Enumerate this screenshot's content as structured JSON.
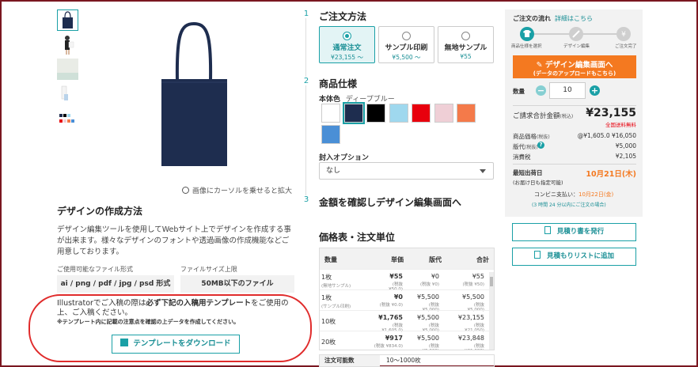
{
  "product": {
    "zoom_hint": "画像にカーソルを乗せると拡大",
    "thumbnails": [
      "tote-navy",
      "model-photo",
      "tote-natural",
      "tote-white",
      "color-variants"
    ]
  },
  "design_howto": {
    "title": "デザインの作成方法",
    "description": "デザイン編集ツールを使用してWebサイト上でデザインを作成する事が出来ます。様々なデザインのフォントや透過画像の作成機能などご用意しております。",
    "file_types_label": "ご使用可能なファイル形式",
    "file_types_value": "ai / png / pdf / jpg / psd 形式",
    "file_size_label": "ファイルサイズ上限",
    "file_size_value": "50MB以下のファイル",
    "note_part1": "Illustratorでご入稿の際は",
    "note_bold": "必ず下記の入稿用テンプレート",
    "note_part2": "をご使用の上、ご入稿ください。",
    "note_small": "※テンプレート内に記載の注意点を確認の上データを作成してください。",
    "download_button": "テンプレートをダウンロード"
  },
  "steps": {
    "step1": {
      "num": "1",
      "title": "ご注文方法"
    },
    "step2": {
      "num": "2",
      "title": "商品仕様"
    },
    "step3": {
      "num": "3",
      "title": "金額を確認しデザイン編集画面へ"
    }
  },
  "order_methods": [
    {
      "title": "通常注文",
      "price": "¥23,155 〜",
      "selected": true
    },
    {
      "title": "サンプル印刷",
      "price": "¥5,500 〜",
      "selected": false
    },
    {
      "title": "無地サンプル",
      "price": "¥55",
      "selected": false
    }
  ],
  "body_color": {
    "label": "本体色",
    "value": "ディープブルー",
    "swatches": [
      "#ffffff",
      "#1e2d4f",
      "#000000",
      "#9fd8ee",
      "#e8000d",
      "#efcfd6",
      "#f47a4a",
      "#4a8fd6"
    ],
    "selected_index": 1
  },
  "sealing": {
    "label": "封入オプション",
    "value": "なし"
  },
  "price_table": {
    "title": "価格表・注文単位",
    "headers": [
      "数量",
      "単価",
      "版代",
      "合計"
    ],
    "rows": [
      {
        "qty": "1枚",
        "qty_sub": "(無地サンプル)",
        "unit": "¥55",
        "unit_sub": "(税抜 ¥50.0)",
        "plate": "¥0",
        "plate_sub": "(税抜 ¥0)",
        "total": "¥55",
        "total_sub": "(税抜 ¥50)"
      },
      {
        "qty": "1枚",
        "qty_sub": "(サンプル印刷)",
        "unit": "¥0",
        "unit_sub": "(税抜 ¥0.0)",
        "plate": "¥5,500",
        "plate_sub": "(税抜 ¥5,000)",
        "total": "¥5,500",
        "total_sub": "(税抜 ¥5,000)"
      },
      {
        "qty": "10枚",
        "qty_sub": "",
        "unit": "¥1,765",
        "unit_sub": "(税抜 ¥1,605.0)",
        "plate": "¥5,500",
        "plate_sub": "(税抜 ¥5,000)",
        "total": "¥23,155",
        "total_sub": "(税抜 ¥21,050)"
      },
      {
        "qty": "20枚",
        "qty_sub": "",
        "unit": "¥917",
        "unit_sub": "(税抜 ¥834.0)",
        "plate": "¥5,500",
        "plate_sub": "(税抜 ¥5,000)",
        "total": "¥23,848",
        "total_sub": "(税抜 ¥21,680)"
      }
    ],
    "order_qty_label": "注文可能数",
    "order_qty_value": "10〜1000枚"
  },
  "summary": {
    "flow_label": "ご注文の流れ",
    "flow_link": "詳細はこちら",
    "flow_steps": [
      "商品仕様を選択",
      "デザイン編集",
      "ご注文完了"
    ],
    "design_button_l1": "デザイン編集画面へ",
    "design_button_l2": "(データのアップロードもこちら)",
    "qty_label": "数量",
    "qty_value": "10",
    "total_label": "ご請求合計金額",
    "total_tax": "(税込)",
    "total_value": "¥23,155",
    "free_shipping": "全国送料無料",
    "item_price_label": "商品価格",
    "item_price_tax": "(税抜)",
    "item_price_value": "@¥1,605.0 ¥16,050",
    "plate_label": "版代",
    "plate_tax": "(税抜)",
    "plate_value": "¥5,000",
    "tax_label": "消費税",
    "tax_value": "¥2,105",
    "delivery_label": "最短出荷日",
    "delivery_sub": "(お届け日も指定可能)",
    "delivery_value": "10月21日(木)",
    "conv_label": "コンビニ支払い：",
    "conv_value": "10月22日(金)",
    "conv_note": "(3 時間 24 分以内にご注文の場合)",
    "quote_button": "見積り書を発行",
    "wishlist_button": "見積もりリストに追加"
  },
  "colors": {
    "accent": "#1aa0a6",
    "orange": "#f47920",
    "red": "#e8000d"
  }
}
